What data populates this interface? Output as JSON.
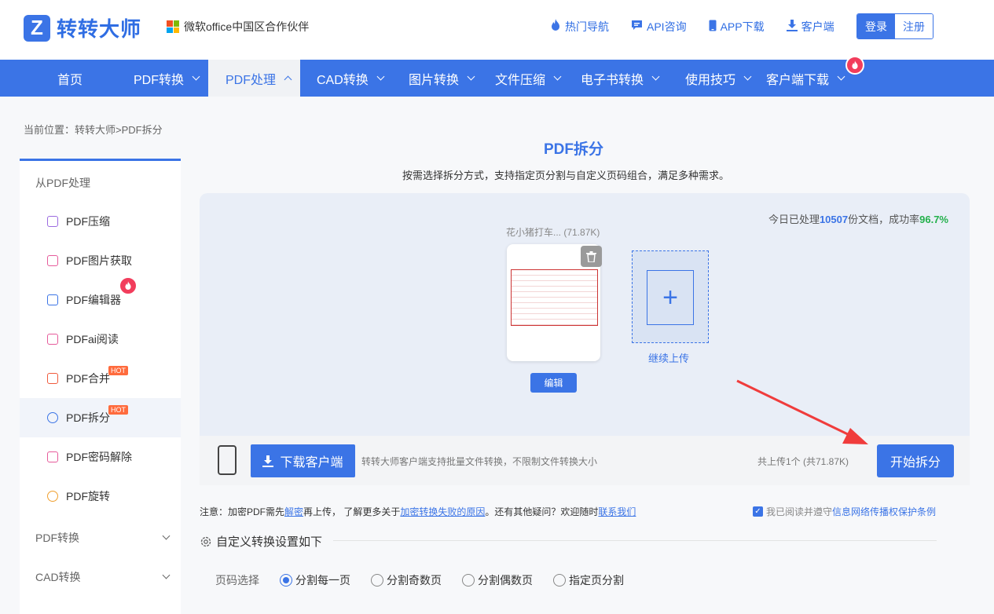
{
  "header": {
    "logo_mark": "Z",
    "logo_text": "转转大师",
    "partner_text": "微软office中国区合作伙伴",
    "links": [
      {
        "label": "热门导航",
        "icon": "flame-icon"
      },
      {
        "label": "API咨询",
        "icon": "chat-icon"
      },
      {
        "label": "APP下载",
        "icon": "phone-icon"
      },
      {
        "label": "客户端",
        "icon": "download-icon"
      }
    ],
    "login": "登录",
    "register": "注册"
  },
  "nav": {
    "items": [
      "首页",
      "PDF转换",
      "PDF处理",
      "CAD转换",
      "图片转换",
      "文件压缩",
      "电子书转换",
      "使用技巧",
      "客户端下载"
    ],
    "active": "PDF处理"
  },
  "breadcrumb": "当前位置：转转大师>PDF拆分",
  "sidebar": {
    "group_title": "从PDF处理",
    "items": [
      {
        "label": "PDF压缩"
      },
      {
        "label": "PDF图片获取"
      },
      {
        "label": "PDF编辑器"
      },
      {
        "label": "PDFai阅读"
      },
      {
        "label": "PDF合并",
        "badge": "HOT"
      },
      {
        "label": "PDF拆分",
        "badge": "HOT"
      },
      {
        "label": "PDF密码解除"
      },
      {
        "label": "PDF旋转"
      }
    ],
    "categories": [
      "PDF转换",
      "CAD转换"
    ]
  },
  "main": {
    "title": "PDF拆分",
    "subtitle": "按需选择拆分方式，支持指定页分割与自定义页码组合，满足多种需求。",
    "stats_prefix": "今日已处理",
    "stats_count": "10507",
    "stats_mid": "份文档，成功率",
    "stats_rate": "96.7%",
    "file_name": "花小猪打车... (71.87K)",
    "edit_label": "编辑",
    "add_label": "继续上传",
    "download_client": "下载客户端",
    "download_note": "转转大师客户端支持批量文件转换，不限制文件转换大小",
    "upload_count": "共上传1个 (共71.87K)",
    "start_button": "开始拆分"
  },
  "notice": {
    "p1": "注意：加密PDF需先",
    "link1": "解密",
    "p2": "再上传，  了解更多关于",
    "link2": "加密转换失败的原因",
    "p3": "。还有其他疑问？欢迎随时",
    "link3": "联系我们"
  },
  "agree": {
    "text": "我已阅读并遵守",
    "link": "信息网络传播权保护条例"
  },
  "settings": {
    "title": "自定义转换设置如下",
    "page_label": "页码选择",
    "options": [
      "分割每一页",
      "分割奇数页",
      "分割偶数页",
      "指定页分割"
    ],
    "selected": "分割每一页"
  }
}
